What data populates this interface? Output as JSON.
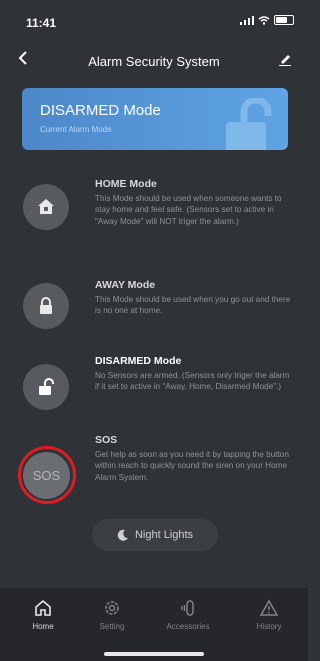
{
  "status": {
    "time": "11:41"
  },
  "nav": {
    "title": "Alarm Security System"
  },
  "current_mode": {
    "title": "DISARMED Mode",
    "subtitle": "Current Alarm Mode"
  },
  "modes": [
    {
      "title": "HOME Mode",
      "desc": "This Mode should be used when someone wants to stay home and feel safe. (Sensors set to active in \"Away Mode\" will NOT triger the alarm.)"
    },
    {
      "title": "AWAY Mode",
      "desc": "This Mode should be used when you go out and there is no one at home."
    },
    {
      "title": "DISARMED Mode",
      "desc": "No Sensors are armed. (Sensors only triger the alarm if it set to active in \"Away, Home, Disarmed Mode\".)"
    }
  ],
  "sos": {
    "button_label": "SOS",
    "title": "SOS",
    "desc": "Get help as soon as you need it by tapping the button within reach to quickly sound the siren on your Home Alarm System."
  },
  "night_lights": {
    "label": "Night Lights"
  },
  "tabs": [
    {
      "label": "Home",
      "icon": "home-icon"
    },
    {
      "label": "Setting",
      "icon": "gear-icon"
    },
    {
      "label": "Accessories",
      "icon": "accessories-icon"
    },
    {
      "label": "History",
      "icon": "warning-icon"
    }
  ],
  "colors": {
    "background": "#2f3237",
    "card": "#5fa4e4",
    "sos_highlight": "#e01b22"
  }
}
